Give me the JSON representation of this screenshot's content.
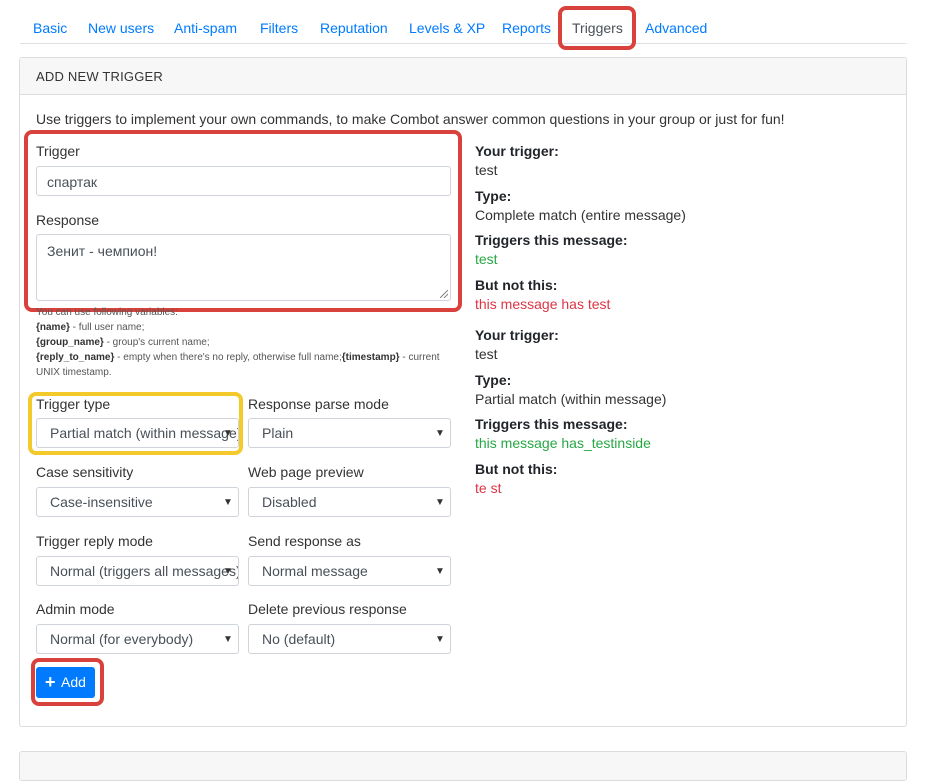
{
  "tabs": [
    "Basic",
    "New users",
    "Anti-spam",
    "Filters",
    "Reputation",
    "Levels & XP",
    "Reports",
    "Triggers",
    "Advanced"
  ],
  "card": {
    "title": "ADD NEW TRIGGER",
    "intro": "Use triggers to implement your own commands, to make Combot answer common questions in your group or just for fun!"
  },
  "form": {
    "trigger_label": "Trigger",
    "trigger_value": "спартак",
    "response_label": "Response",
    "response_value": "Зенит - чемпион!",
    "help": {
      "line1": "You can use following variables:",
      "name_var": "{name}",
      "name_desc": " - full user name;",
      "group_var": "{group_name}",
      "group_desc": " - group's current name;",
      "reply_var": "{reply_to_name}",
      "reply_desc": " - empty when there's no reply, otherwise full name;",
      "ts_var": "{timestamp}",
      "ts_desc1": " - current",
      "ts_desc2": "UNIX timestamp."
    },
    "trigger_type": {
      "label": "Trigger type",
      "value": "Partial match (within message)"
    },
    "parse_mode": {
      "label": "Response parse mode",
      "value": "Plain"
    },
    "case": {
      "label": "Case sensitivity",
      "value": "Case-insensitive"
    },
    "preview": {
      "label": "Web page preview",
      "value": "Disabled"
    },
    "reply_mode": {
      "label": "Trigger reply mode",
      "value": "Normal (triggers all messages)"
    },
    "send_as": {
      "label": "Send response as",
      "value": "Normal message"
    },
    "admin_mode": {
      "label": "Admin mode",
      "value": "Normal (for everybody)"
    },
    "delete_prev": {
      "label": "Delete previous response",
      "value": "No (default)"
    },
    "add_label": "Add"
  },
  "examples": [
    {
      "your_trigger_label": "Your trigger:",
      "your_trigger": "test",
      "type_label": "Type:",
      "type": "Complete match (entire message)",
      "triggers_label": "Triggers this message:",
      "triggers": "test",
      "not_label": "But not this:",
      "not": "this message has test"
    },
    {
      "your_trigger_label": "Your trigger:",
      "your_trigger": "test",
      "type_label": "Type:",
      "type": "Partial match (within message)",
      "triggers_label": "Triggers this message:",
      "triggers": "this message has_testinside",
      "not_label": "But not this:",
      "not": "te st"
    }
  ],
  "colors": {
    "link": "#007bff",
    "primary": "#007bff",
    "highlight_red": "#d9413c",
    "highlight_yellow": "#f3c92c",
    "success": "#28a745",
    "danger": "#dc3545"
  }
}
